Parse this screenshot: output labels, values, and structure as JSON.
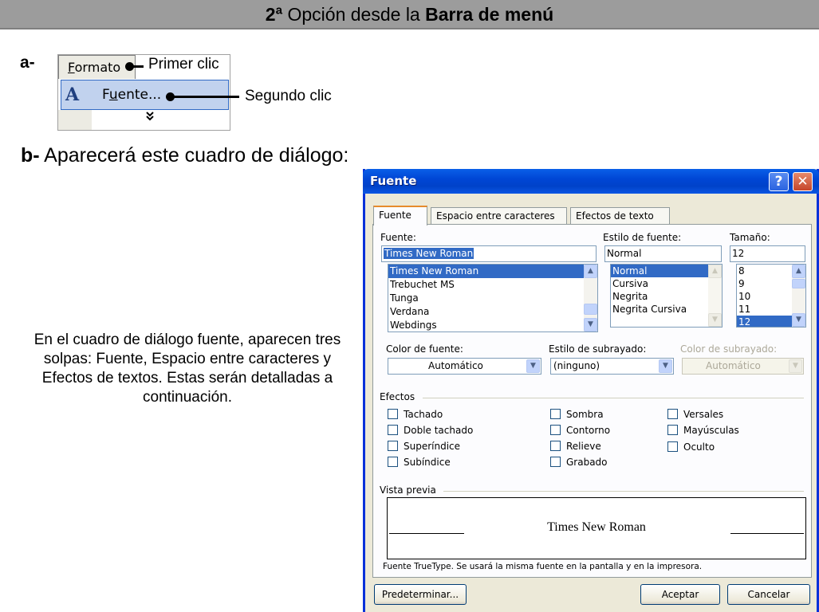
{
  "header": {
    "prefix": "2ª",
    "middle": " Opción desde la ",
    "bold": "Barra de menú"
  },
  "step_a": "a-",
  "step_b": {
    "letter": "b-",
    "text": " Aparecerá este cuadro de diálogo:"
  },
  "menu": {
    "title": "Formato",
    "title_accel_pre": "",
    "title_accel": "F",
    "title_rest": "ormato",
    "item_pre": "F",
    "item_accel": "u",
    "item_rest": "ente...",
    "chevron": "»"
  },
  "callouts": {
    "first": "Primer clic",
    "second": "Segundo clic"
  },
  "description": "En el cuadro de diálogo fuente, aparecen tres solpas: Fuente, Espacio entre caracteres y Efectos de textos. Estas serán detalladas a continuación.",
  "dialog": {
    "title": "Fuente",
    "help_label": "?",
    "close_label": "✕",
    "tabs": [
      "Fuente",
      "Espacio entre caracteres",
      "Efectos de texto"
    ],
    "font_label": "Fuente:",
    "font_value": "Times New Roman",
    "font_list": [
      "Times New Roman",
      "Trebuchet MS",
      "Tunga",
      "Verdana",
      "Webdings"
    ],
    "style_label": "Estilo de fuente:",
    "style_value": "Normal",
    "style_list": [
      "Normal",
      "Cursiva",
      "Negrita",
      "Negrita Cursiva"
    ],
    "size_label": "Tamaño:",
    "size_value": "12",
    "size_list": [
      "8",
      "9",
      "10",
      "11",
      "12"
    ],
    "color_label": "Color de fuente:",
    "color_value": "Automático",
    "underline_label": "Estilo de subrayado:",
    "underline_value": "(ninguno)",
    "underline_color_label": "Color de subrayado:",
    "underline_color_value": "Automático",
    "effects_label": "Efectos",
    "effects_col1": [
      "Tachado",
      "Doble tachado",
      "Superíndice",
      "Subíndice"
    ],
    "effects_col2": [
      "Sombra",
      "Contorno",
      "Relieve",
      "Grabado"
    ],
    "effects_col3": [
      "Versales",
      "Mayúsculas",
      "Oculto"
    ],
    "preview_label": "Vista previa",
    "preview_text": "Times New Roman",
    "truetype_note": "Fuente TrueType. Se usará la misma fuente en la pantalla y en la impresora.",
    "btn_default": "Predeterminar...",
    "btn_ok": "Aceptar",
    "btn_cancel": "Cancelar"
  }
}
